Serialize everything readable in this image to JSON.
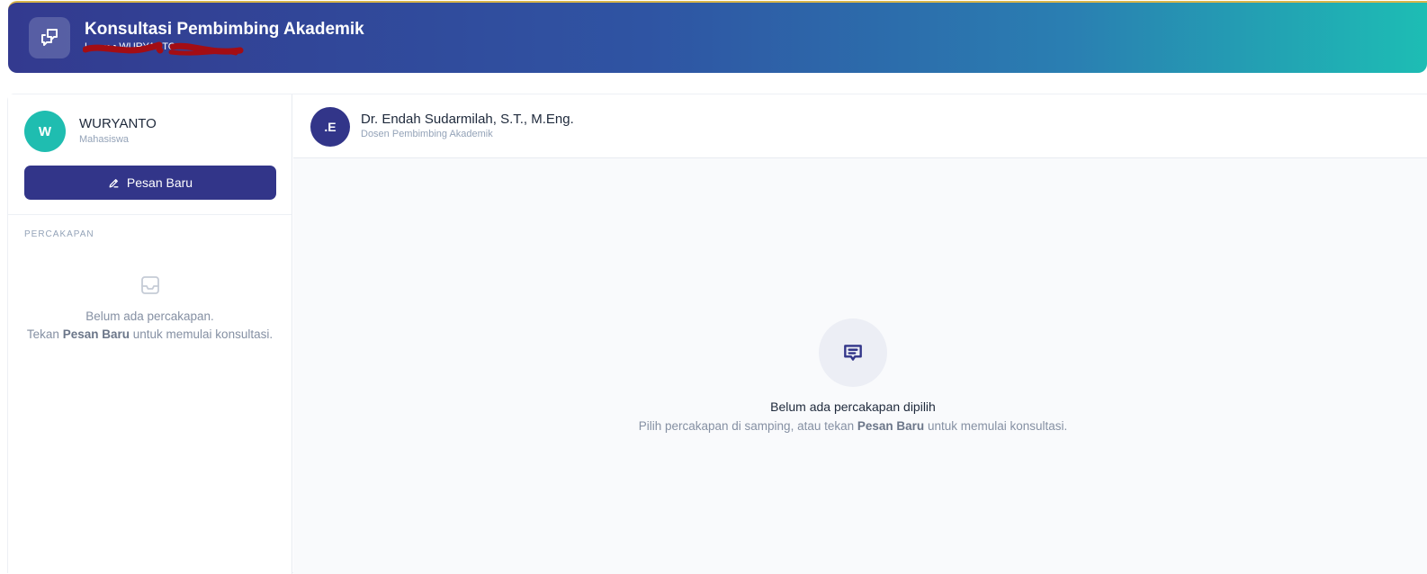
{
  "header": {
    "title": "Konsultasi Pembimbing Akademik",
    "subtitle": "L.••••• • WURYANTO",
    "icon": "chat-bubbles-icon"
  },
  "sidebar": {
    "user": {
      "initial": "W",
      "name": "WURYANTO",
      "role": "Mahasiswa"
    },
    "new_message_label": "Pesan Baru",
    "section_label": "PERCAKAPAN",
    "empty": {
      "line1": "Belum ada percakapan.",
      "line2_prefix": "Tekan",
      "line2_emphasis": "Pesan Baru",
      "line2_suffix": "untuk memulai konsultasi."
    }
  },
  "chat": {
    "lecturer": {
      "initial": ".E",
      "name": "Dr. Endah Sudarmilah, S.T., M.Eng.",
      "role": "Dosen Pembimbing Akademik"
    },
    "empty": {
      "title": "Belum ada percakapan dipilih",
      "desc_prefix": "Pilih percakapan di samping, atau tekan",
      "desc_emphasis": "Pesan Baru",
      "desc_suffix": "untuk memulai konsultasi."
    }
  },
  "colors": {
    "primary": "#323589",
    "accent_teal": "#1fbdb0",
    "muted_text": "#94a3b8",
    "redaction": "#a30d14"
  }
}
